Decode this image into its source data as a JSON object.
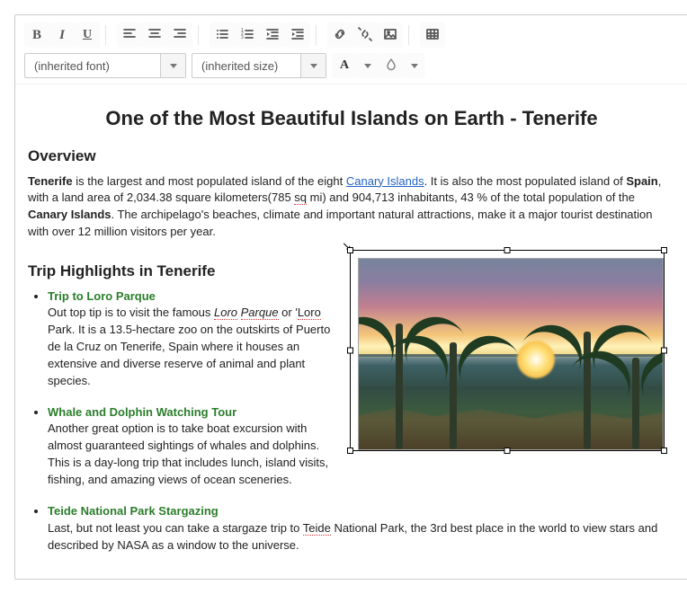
{
  "toolbar": {
    "font_selector": "(inherited font)",
    "size_selector": "(inherited size)"
  },
  "doc": {
    "title": "One of the Most Beautiful Islands on Earth - Tenerife",
    "overview_heading": "Overview",
    "overview_parts": {
      "p1a": "Tenerife",
      "p1b": " is the largest and most populated island of the eight ",
      "link_text": "Canary Islands",
      "p1c": ". It is also the most populated island of ",
      "p1d": "Spain",
      "p1e": ", with a land area of 2,034.38 square kilometers(785 ",
      "sq": "sq",
      "p1f": " mi) and 904,713 inhabitants, 43 % of the total population of the ",
      "p1g": "Canary Islands",
      "p1h": ". The archipelago's beaches, climate and important natural attractions, make it a major tourist destination with over 12 million visitors per year."
    },
    "highlights_heading": "Trip Highlights in Tenerife",
    "trips": [
      {
        "title": "Trip to Loro Parque",
        "b1": "Out top tip is to visit the famous ",
        "sp1": "Loro",
        "mid1": " ",
        "sp2": "Parque",
        "b2": " or '",
        "sp3": "Loro",
        "b3": " Park. It is a 13.5-hectare zoo on the outskirts of Puerto de la Cruz on Tenerife, Spain where it houses an extensive and diverse reserve of animal and plant species."
      },
      {
        "title": "Whale and Dolphin Watching Tour",
        "body": "Another great option is to take boat excursion with almost guaranteed sightings of whales and dolphins. This is a day-long trip that includes lunch, island visits, fishing, and amazing views of ocean sceneries."
      },
      {
        "title": "Teide National Park Stargazing",
        "b1": "Last, but not least you can take a stargaze trip to ",
        "sp1": "Teide",
        "b2": " National Park, the 3rd best place in the world to view stars and described by NASA as a window to the universe."
      }
    ]
  }
}
